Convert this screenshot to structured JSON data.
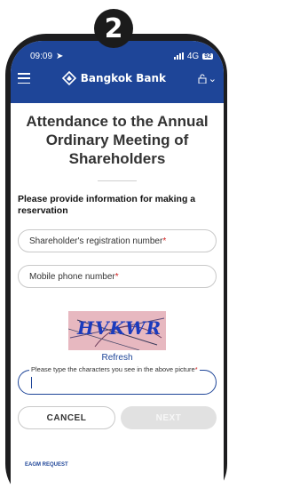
{
  "step_badge": "2",
  "status_bar": {
    "time": "09:09",
    "network": "4G",
    "battery": "92"
  },
  "header": {
    "brand": "Bangkok Bank"
  },
  "page": {
    "title": "Attendance to the Annual Ordinary Meeting of Shareholders",
    "instruction": "Please provide information for making a reservation"
  },
  "form": {
    "registration_placeholder": "Shareholder's registration number",
    "mobile_placeholder": "Mobile phone number",
    "required_marker": "*",
    "captcha_text": "HVKWR",
    "refresh_label": "Refresh",
    "captcha_input_label": "Please type the characters you see in the above picture",
    "captcha_value": ""
  },
  "buttons": {
    "cancel": "CANCEL",
    "next": "NEXT"
  },
  "footer": {
    "link": "EAGM REQUEST"
  },
  "colors": {
    "brand_blue": "#1e4598",
    "required_red": "#d21e1e",
    "disabled_gray": "#e1e1e1"
  }
}
